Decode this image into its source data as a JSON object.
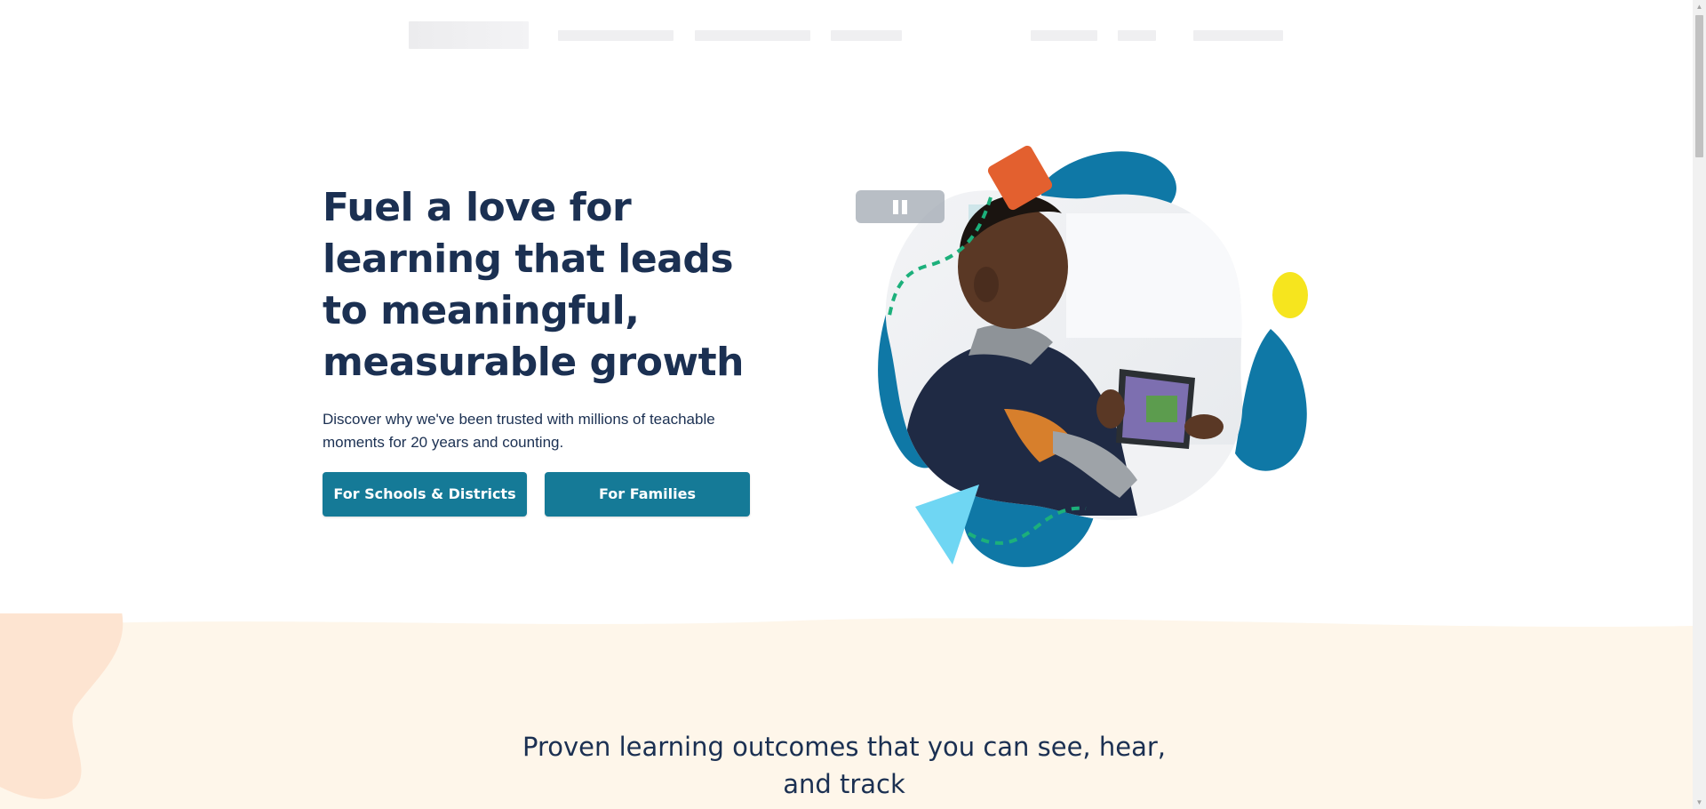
{
  "hero": {
    "title": "Fuel a love for learning that leads to meaningful, measurable growth",
    "subtitle": "Discover why we've been trusted with millions of teachable moments for 20 years and counting.",
    "buttons": {
      "schools": "For Schools & Districts",
      "families": "For Families"
    },
    "media": {
      "pause_icon": "pause-icon",
      "image_alt": "Student smiling while using a tablet"
    }
  },
  "outcomes": {
    "heading": "Proven learning outcomes that you can see, hear, and track"
  },
  "colors": {
    "primary_button": "#157a97",
    "heading_text": "#1b3052",
    "blob_blue": "#0f78a6",
    "accent_orange": "#e3602f",
    "accent_cyan": "#6fd6f3",
    "accent_yellow": "#f6e51e",
    "dashed_green": "#1cb07b",
    "band_cream": "#fef6ea",
    "band_peach": "#fde4d1"
  }
}
